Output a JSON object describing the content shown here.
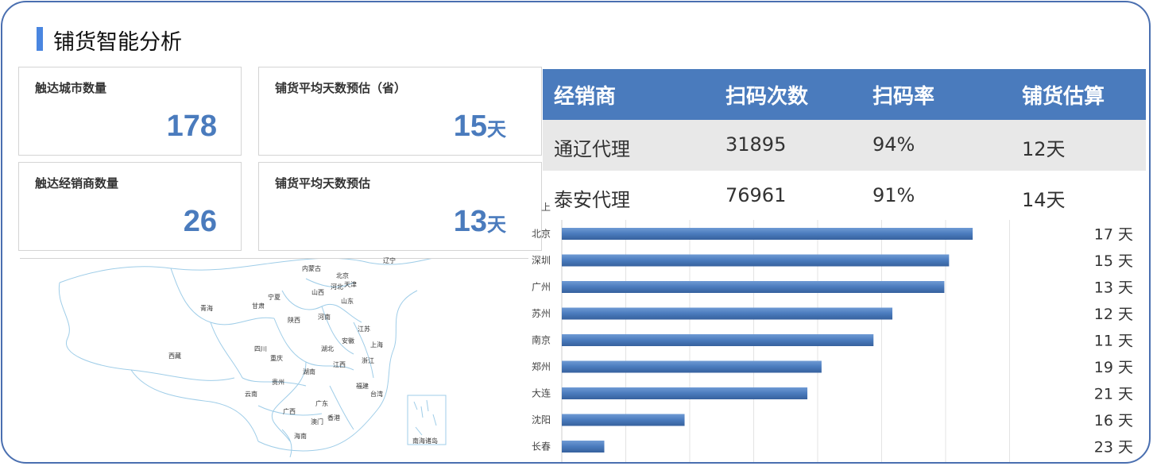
{
  "title": "铺货智能分析",
  "kpis": [
    {
      "label": "触达城市数量",
      "value": "178",
      "unit": ""
    },
    {
      "label": "铺货平均天数预估（省）",
      "value": "15",
      "unit": "天"
    },
    {
      "label": "触达经销商数量",
      "value": "26",
      "unit": ""
    },
    {
      "label": "铺货平均天数预估",
      "value": "13",
      "unit": "天"
    }
  ],
  "distributor_table": {
    "headers": [
      "经销商",
      "扫码次数",
      "扫码率",
      "铺货估算"
    ],
    "rows": [
      [
        "通辽代理",
        "31895",
        "94%",
        "12天"
      ],
      [
        "泰安代理",
        "76961",
        "91%",
        "14天"
      ]
    ]
  },
  "map": {
    "labels": [
      "内蒙古",
      "北京",
      "辽宁",
      "天津",
      "河北",
      "宁夏",
      "山西",
      "山东",
      "青海",
      "甘肃",
      "陕西",
      "河南",
      "江苏",
      "安徽",
      "上海",
      "西藏",
      "四川",
      "重庆",
      "湖北",
      "浙江",
      "江西",
      "湖南",
      "贵州",
      "福建",
      "云南",
      "广西",
      "广东",
      "台湾",
      "香港",
      "澳门",
      "海南",
      "南海诸岛"
    ],
    "line_color": "#9fcde8"
  },
  "chart_data": {
    "type": "bar",
    "orientation": "horizontal",
    "categories": [
      "上",
      "北京",
      "深圳",
      "广州",
      "苏州",
      "南京",
      "郑州",
      "大连",
      "沈阳",
      "长春"
    ],
    "values": [
      null,
      17,
      15,
      13,
      12,
      11,
      19,
      21,
      16,
      23
    ],
    "bar_lengths_relative": [
      null,
      0.87,
      0.82,
      0.81,
      0.7,
      0.66,
      0.55,
      0.52,
      0.26,
      0.09
    ],
    "value_labels": [
      "",
      "17 天",
      "15 天",
      "13 天",
      "12 天",
      "11 天",
      "19 天",
      "21 天",
      "16 天",
      "23 天"
    ],
    "bar_color": "#4a7bbd",
    "grid": true
  }
}
